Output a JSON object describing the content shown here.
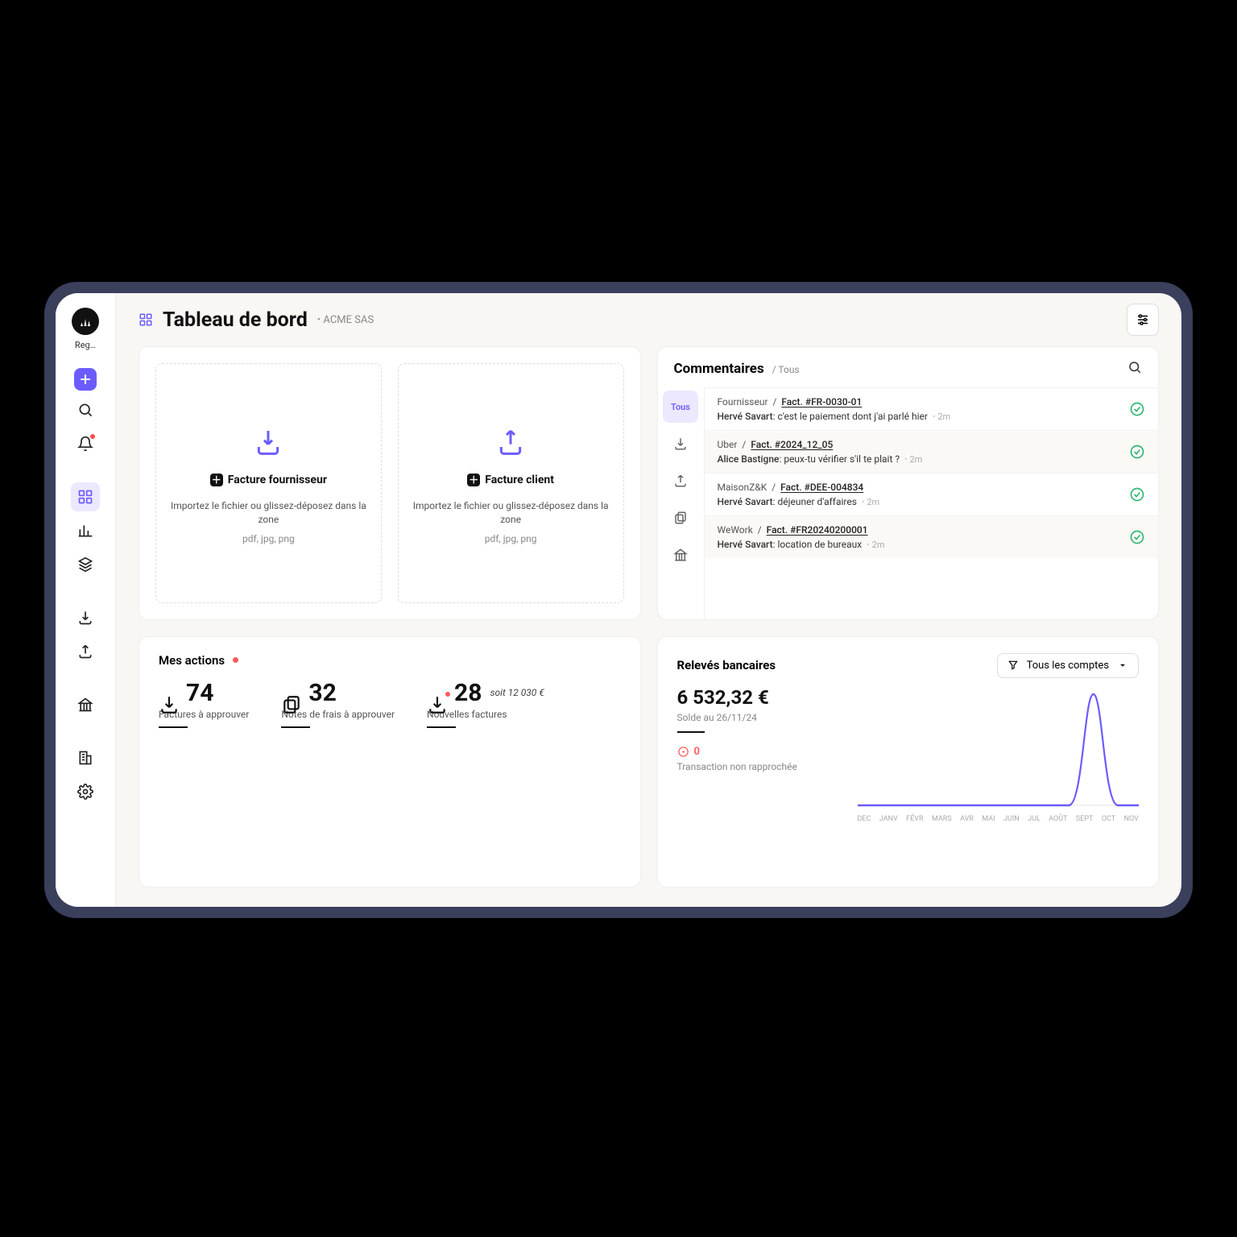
{
  "sidebar": {
    "username": "Reg…",
    "icons": [
      "plus",
      "search",
      "bell",
      "dashboard",
      "layers",
      "stack",
      "download-in",
      "download-out",
      "bank",
      "buildings",
      "gear"
    ]
  },
  "header": {
    "title": "Tableau de bord",
    "company": "ACME SAS"
  },
  "uploads": [
    {
      "label": "Facture fournisseur",
      "hint": "Importez le fichier ou glissez-déposez dans la zone",
      "formats": "pdf, jpg, png",
      "icon": "download"
    },
    {
      "label": "Facture client",
      "hint": "Importez le fichier ou glissez-déposez dans la zone",
      "formats": "pdf, jpg, png",
      "icon": "upload"
    }
  ],
  "comments": {
    "title": "Commentaires",
    "scope": "Tous",
    "tabs": [
      "Tous",
      "inbox",
      "outbox",
      "copy",
      "bank"
    ],
    "items": [
      {
        "supplier": "Fournisseur",
        "ref": "Fact.  #FR-0030-01",
        "author": "Hervé Savart",
        "text": "c'est le paiement dont j'ai parlé hier",
        "time": "2m"
      },
      {
        "supplier": "Uber",
        "ref": "Fact.  #2024_12_05",
        "author": "Alice Bastigne",
        "text": "peux-tu vérifier s'il te plait ?",
        "time": "2m"
      },
      {
        "supplier": "MaisonZ&K",
        "ref": "Fact.  #DEE-004834",
        "author": "Hervé Savart",
        "text": "déjeuner d'affaires",
        "time": "2m"
      },
      {
        "supplier": "WeWork",
        "ref": "Fact.  #FR20240200001",
        "author": "Hervé Savart",
        "text": "location de bureaux",
        "time": "2m"
      }
    ]
  },
  "actions": {
    "title": "Mes actions",
    "items": [
      {
        "icon": "download",
        "value": "74",
        "label": "Factures à approuver"
      },
      {
        "icon": "copy",
        "value": "32",
        "label": "Notes de frais à approuver"
      },
      {
        "icon": "download",
        "value": "28",
        "sub": "soit 12 030 €",
        "label": "Nouvelles factures",
        "reddot": true
      }
    ]
  },
  "bank": {
    "title": "Relevés bancaires",
    "selector": "Tous les comptes",
    "balance": "6 532,32 €",
    "balance_date": "Solde au 26/11/24",
    "warn_count": "0",
    "warn_label": "Transaction non rapprochée"
  },
  "chart_data": {
    "type": "line",
    "title": "",
    "xlabel": "",
    "ylabel": "",
    "categories": [
      "DEC",
      "JANV",
      "FÉVR",
      "MARS",
      "AVR",
      "MAI",
      "JUIN",
      "JUL",
      "AOÛT",
      "SEPT",
      "OCT",
      "NOV"
    ],
    "values": [
      0,
      0,
      0,
      0,
      0,
      0,
      0,
      0,
      0,
      0,
      6532,
      0
    ],
    "ylim": [
      0,
      7000
    ],
    "color": "#6b5cff"
  }
}
